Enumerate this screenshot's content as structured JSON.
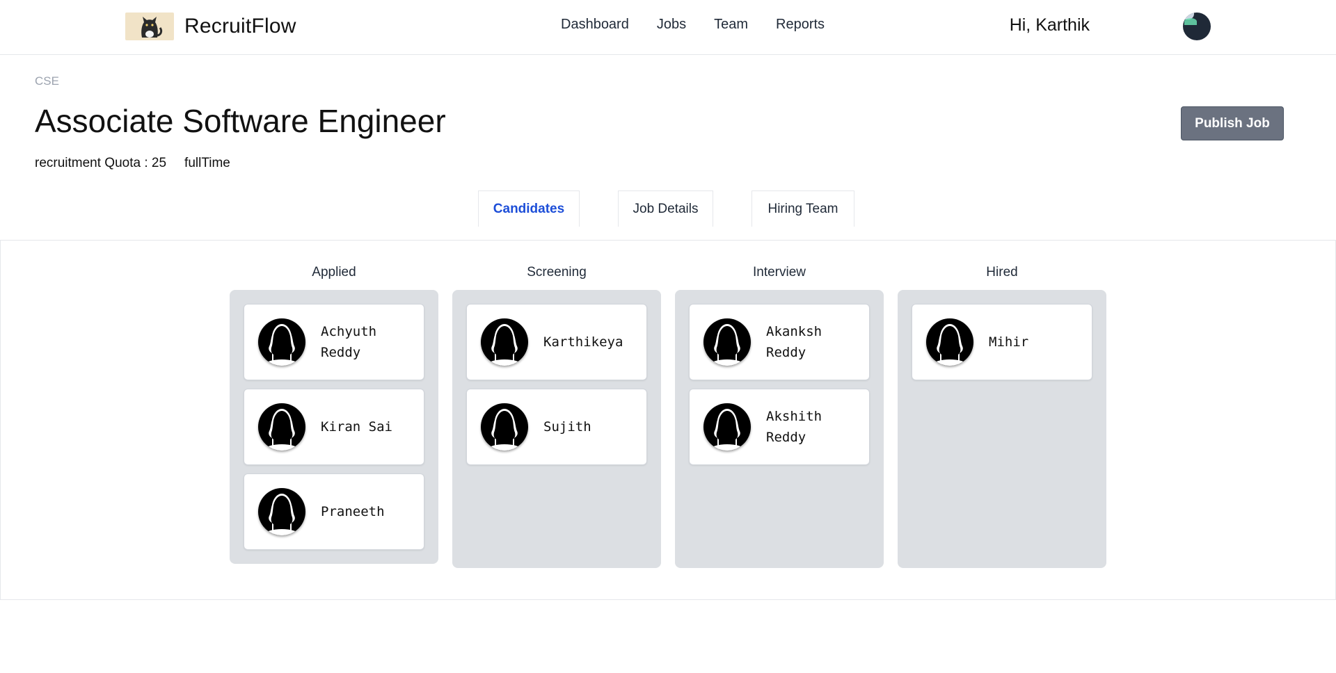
{
  "brand": {
    "name": "RecruitFlow",
    "logo_icon": "cat-logo-icon"
  },
  "nav": [
    "Dashboard",
    "Jobs",
    "Team",
    "Reports"
  ],
  "user": {
    "greeting": "Hi, Karthik",
    "avatar_icon": "user-avatar-icon"
  },
  "job": {
    "department": "CSE",
    "title": "Associate Software Engineer",
    "quota": "recruitment Quota : 25",
    "type": "fullTime",
    "publish_label": "Publish Job"
  },
  "tabs": {
    "candidates": "Candidates",
    "job_details": "Job Details",
    "hiring_team": "Hiring Team",
    "active": "Candidates"
  },
  "colors": {
    "accent": "#1d4ed8",
    "button": "#6b7280",
    "column_bg": "#dcdfe3"
  },
  "pipeline": [
    {
      "stage": "Applied",
      "candidates": [
        "Achyuth Reddy",
        "Kiran Sai",
        "Praneeth"
      ]
    },
    {
      "stage": "Screening",
      "candidates": [
        "Karthikeya",
        "Sujith"
      ]
    },
    {
      "stage": "Interview",
      "candidates": [
        "Akanksh Reddy",
        "Akshith Reddy"
      ]
    },
    {
      "stage": "Hired",
      "candidates": [
        "Mihir"
      ]
    }
  ]
}
